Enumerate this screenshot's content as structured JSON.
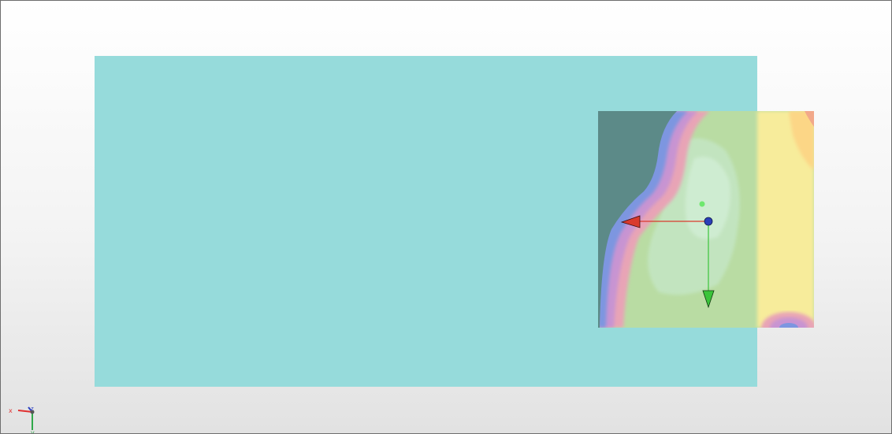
{
  "viewport": {
    "background_top": "#ffffff",
    "background_bottom": "#e2e2e2",
    "border_color": "#6e6e6e"
  },
  "scene": {
    "base_plate_color": "#96dbdb",
    "contour_plot_colors": [
      "#5c8a88",
      "#7d96e0",
      "#c894d2",
      "#e8a4b6",
      "#b8d88c",
      "#c4e6c4",
      "#f6ec9a",
      "#fcd686"
    ],
    "transform_gizmo": {
      "center_icon": "sphere-handle-icon",
      "x_arrow_color": "#d93a2e",
      "y_arrow_color": "#3ac43a",
      "center_color": "#2a3fb8"
    }
  },
  "orientation_axes": {
    "x_label": "x",
    "y_label": "y",
    "z_label": "z",
    "x_color": "#e03030",
    "y_color": "#2fa84a",
    "z_color": "#2c3fbf"
  }
}
